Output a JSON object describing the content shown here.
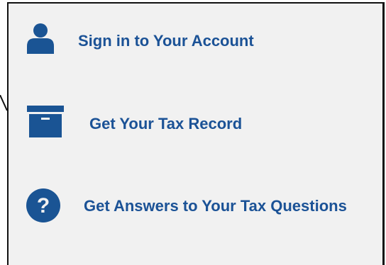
{
  "links": [
    {
      "label": "Sign in to Your Account",
      "icon": "user-icon"
    },
    {
      "label": "Get Your Tax Record",
      "icon": "archive-box-icon"
    },
    {
      "label": "Get Answers to Your Tax Questions",
      "icon": "question-circle-icon"
    }
  ],
  "colors": {
    "link": "#1b5296",
    "icon": "#1a5494",
    "panel_background": "#f1f1f1",
    "border": "#111111"
  }
}
